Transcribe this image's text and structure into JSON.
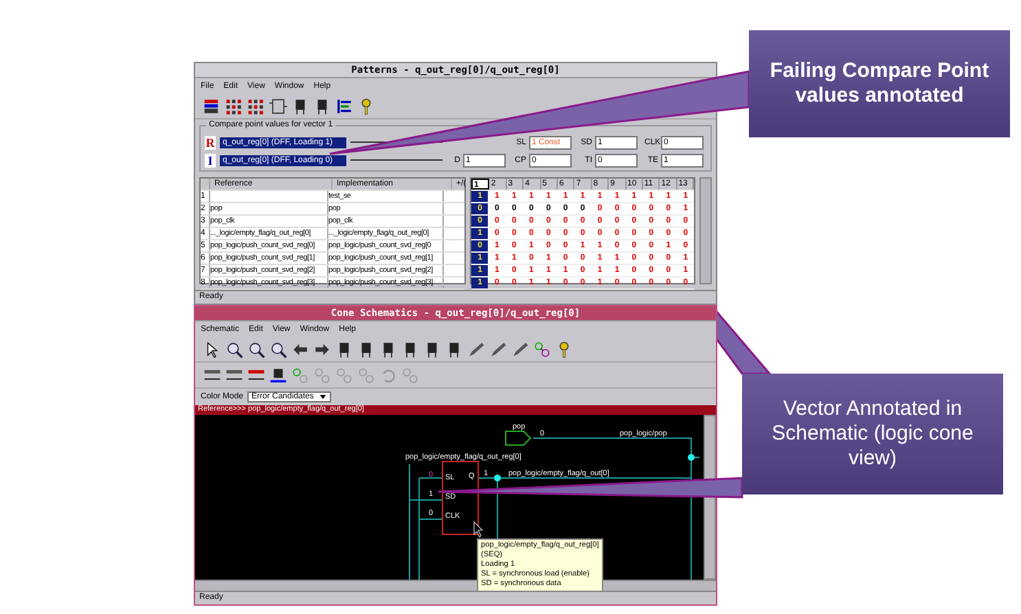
{
  "patterns_window": {
    "title": "Patterns - q_out_reg[0]/q_out_reg[0]",
    "menu": [
      "File",
      "Edit",
      "View",
      "Window",
      "Help"
    ],
    "group_title": "Compare point values for vector 1",
    "points": [
      {
        "tag": "R",
        "text": "q_out_reg[0] (DFF, Loading 1)"
      },
      {
        "tag": "I",
        "text": "q_out_reg[0] (DFF, Loading 0)"
      }
    ],
    "pin_rows": [
      [
        {
          "label": "SL",
          "value": "1 Const",
          "failing": true
        },
        {
          "label": "SD",
          "value": "1",
          "failing": false
        },
        {
          "label": "CLK",
          "value": "0",
          "failing": false
        }
      ],
      [
        {
          "label": "D",
          "value": "1",
          "failing": false
        },
        {
          "label": "CP",
          "value": "0",
          "failing": false
        },
        {
          "label": "TI",
          "value": "0",
          "failing": false
        },
        {
          "label": "TE",
          "value": "1",
          "failing": false
        }
      ]
    ],
    "table": {
      "columns": [
        "Reference",
        "Implementation",
        "+/("
      ],
      "rows": [
        {
          "num": "1",
          "implementation": "test_se"
        },
        {
          "num": "2",
          "reference": "pop",
          "implementation": "pop"
        },
        {
          "num": "3",
          "reference": "pop_clk",
          "implementation": "pop_clk"
        },
        {
          "num": "4",
          "reference": "..._logic/empty_flag/q_out_reg[0]",
          "implementation": "..._logic/empty_flag/q_out_reg[0]"
        },
        {
          "num": "5",
          "reference": "pop_logic/push_count_svd_reg[0]",
          "implementation": "pop_logic/push_count_svd_reg[0"
        },
        {
          "num": "6",
          "reference": "pop_logic/push_count_svd_reg[1]",
          "implementation": "pop_logic/push_count_svd_reg[1]"
        },
        {
          "num": "7",
          "reference": "pop_logic/push_count_svd_reg[2]",
          "implementation": "pop_logic/push_count_svd_reg[2]"
        },
        {
          "num": "8",
          "reference": "pop_logic/push_count_svd_reg[3]",
          "implementation": "pop_logic/push_count_svd_reg[3]"
        }
      ]
    },
    "vector_grid": {
      "columns": [
        {
          "label": "1",
          "selected": true
        },
        {
          "label": "2",
          "selected": false
        },
        {
          "label": "3",
          "selected": false
        },
        {
          "label": "4",
          "selected": false
        },
        {
          "label": "5",
          "selected": false
        },
        {
          "label": "6",
          "selected": false
        },
        {
          "label": "7",
          "selected": false
        },
        {
          "label": "8",
          "selected": false
        },
        {
          "label": "9",
          "selected": false
        },
        {
          "label": "10",
          "selected": false
        },
        {
          "label": "11",
          "selected": false
        },
        {
          "label": "12",
          "selected": false
        },
        {
          "label": "13",
          "selected": false
        }
      ],
      "rows": [
        {
          "values": [
            "1",
            "1",
            "1",
            "1",
            "1",
            "1",
            "1",
            "1",
            "1",
            "1",
            "1",
            "1",
            "1"
          ],
          "failing": [
            false,
            true,
            true,
            true,
            true,
            true,
            true,
            true,
            true,
            true,
            true,
            true,
            true
          ]
        },
        {
          "values": [
            "0",
            "0",
            "0",
            "0",
            "0",
            "0",
            "0",
            "0",
            "0",
            "0",
            "0",
            "0",
            "1"
          ],
          "failing": [
            false,
            false,
            false,
            false,
            false,
            false,
            false,
            true,
            true,
            true,
            true,
            true,
            true
          ]
        },
        {
          "values": [
            "0",
            "0",
            "0",
            "0",
            "0",
            "0",
            "0",
            "0",
            "0",
            "0",
            "0",
            "0",
            "0"
          ],
          "failing": [
            false,
            true,
            true,
            true,
            true,
            true,
            true,
            true,
            true,
            true,
            true,
            true,
            true
          ]
        },
        {
          "values": [
            "1",
            "0",
            "0",
            "0",
            "0",
            "0",
            "0",
            "0",
            "0",
            "0",
            "0",
            "0",
            "0"
          ],
          "failing": [
            false,
            true,
            true,
            true,
            true,
            true,
            true,
            true,
            true,
            true,
            true,
            true,
            true
          ]
        },
        {
          "values": [
            "0",
            "1",
            "0",
            "1",
            "0",
            "0",
            "1",
            "1",
            "0",
            "0",
            "0",
            "1",
            "0"
          ],
          "failing": [
            false,
            true,
            true,
            true,
            true,
            true,
            true,
            true,
            true,
            true,
            true,
            true,
            true
          ]
        },
        {
          "values": [
            "1",
            "1",
            "1",
            "0",
            "1",
            "0",
            "0",
            "1",
            "1",
            "0",
            "0",
            "0",
            "1"
          ],
          "failing": [
            false,
            true,
            true,
            true,
            true,
            true,
            true,
            true,
            true,
            true,
            true,
            true,
            true
          ]
        },
        {
          "values": [
            "1",
            "1",
            "0",
            "1",
            "1",
            "1",
            "0",
            "1",
            "1",
            "0",
            "0",
            "0",
            "1"
          ],
          "failing": [
            false,
            true,
            true,
            true,
            true,
            true,
            true,
            true,
            true,
            true,
            true,
            true,
            true
          ]
        },
        {
          "values": [
            "1",
            "0",
            "0",
            "1",
            "1",
            "0",
            "0",
            "1",
            "0",
            "0",
            "0",
            "0",
            "0"
          ],
          "failing": [
            false,
            true,
            true,
            true,
            true,
            true,
            true,
            true,
            true,
            true,
            true,
            true,
            true
          ]
        }
      ]
    },
    "status": "Ready"
  },
  "schematic_window": {
    "title": "Cone Schematics - q_out_reg[0]/q_out_reg[0]",
    "menu": [
      "Schematic",
      "Edit",
      "View",
      "Window",
      "Help"
    ],
    "color_mode_label": "Color Mode",
    "color_mode_value": "Error Candidates",
    "reference_path": "Reference>>> pop_logic/empty_flag/q_out_reg[0]",
    "schematic": {
      "input_name": "pop",
      "input_value": "0",
      "input_net": "pop_logic/pop",
      "cell_name": "pop_logic/empty_flag/q_out_reg[0]",
      "pins": [
        {
          "label": "SL",
          "value": "0",
          "failing": true
        },
        {
          "label": "SD",
          "value": "1",
          "failing": false
        },
        {
          "label": "CLK",
          "value": "0",
          "failing": false
        }
      ],
      "output_pin": "Q",
      "output_value": "1",
      "output_net": "pop_logic/empty_flag/q_out[0]"
    },
    "tooltip": [
      "pop_logic/empty_flag/q_out_reg[0]",
      "(SEQ)",
      "Loading 1",
      "SL = synchronous load (enable)",
      "SD = synchronous data"
    ],
    "status": "Ready"
  },
  "callouts": [
    {
      "text": "Failing Compare Point values annotated",
      "emphasis": true
    },
    {
      "text": "Vector Annotated in Schematic (logic cone view)",
      "emphasis": false
    }
  ]
}
